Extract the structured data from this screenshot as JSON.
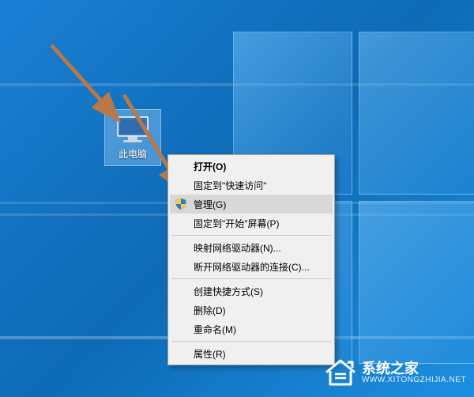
{
  "desktop": {
    "icon_label": "此电脑"
  },
  "context_menu": {
    "open": "打开(O)",
    "pin_quick_access": "固定到\"快速访问\"",
    "manage": "管理(G)",
    "pin_start": "固定到\"开始\"屏幕(P)",
    "map_drive": "映射网络驱动器(N)...",
    "disconnect_drive": "断开网络驱动器的连接(C)...",
    "create_shortcut": "创建快捷方式(S)",
    "delete": "删除(D)",
    "rename": "重命名(M)",
    "properties": "属性(R)"
  },
  "watermark": {
    "title": "系统之家",
    "url": "WWW.XITONGZHIJIA.NET"
  }
}
